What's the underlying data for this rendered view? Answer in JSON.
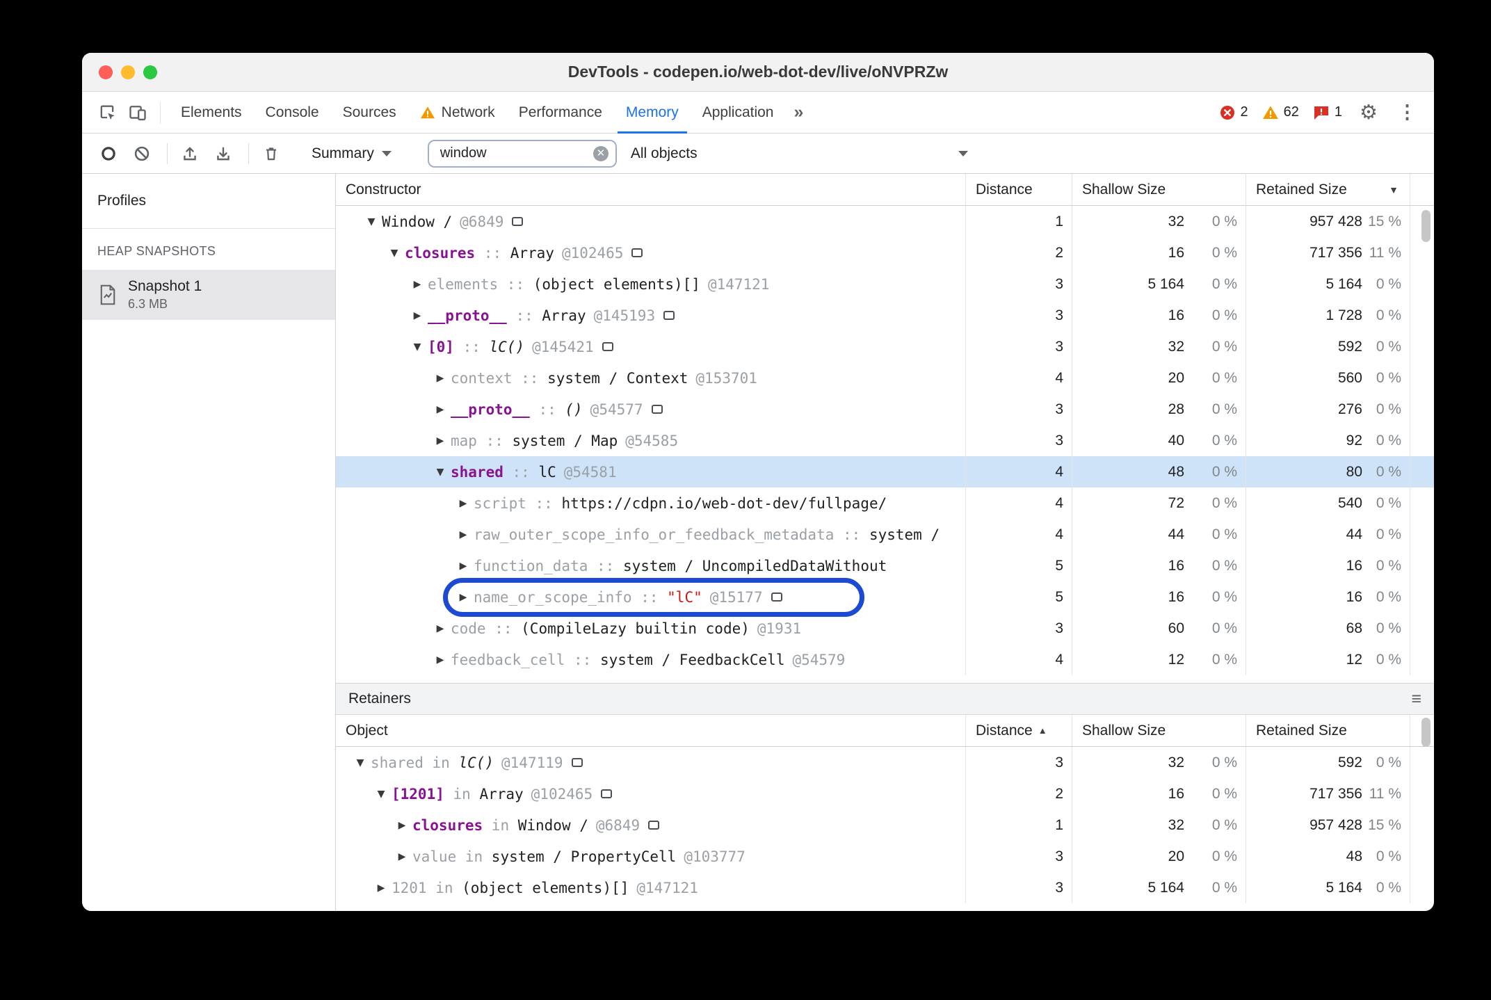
{
  "window": {
    "title": "DevTools - codepen.io/web-dot-dev/live/oNVPRZw"
  },
  "tabs": {
    "items": [
      {
        "label": "Elements"
      },
      {
        "label": "Console"
      },
      {
        "label": "Sources"
      },
      {
        "label": "Network",
        "warning": true
      },
      {
        "label": "Performance"
      },
      {
        "label": "Memory",
        "selected": true
      },
      {
        "label": "Application"
      }
    ],
    "more_label": "»",
    "errors": "2",
    "warnings": "62",
    "issues": "1"
  },
  "toolbar": {
    "summary_label": "Summary",
    "search_value": "window",
    "objects_filter": "All objects"
  },
  "sidebar": {
    "title": "Profiles",
    "section": "HEAP SNAPSHOTS",
    "snapshot": {
      "name": "Snapshot 1",
      "size": "6.3 MB"
    }
  },
  "constructor_table": {
    "columns": {
      "name": "Constructor",
      "distance": "Distance",
      "shallow": "Shallow Size",
      "retained": "Retained Size"
    },
    "sort": "retained-desc",
    "rows": [
      {
        "level": 0,
        "arrow": "open",
        "name": "Window /",
        "name_style": "plain",
        "sep": "",
        "value": "",
        "value_style": "plain",
        "id": "@6849",
        "icon": true,
        "selected": false,
        "annotated": false,
        "distance": "1",
        "shallow": "32",
        "shallow_pct": "0 %",
        "retained": "957 428",
        "retained_pct": "15 %"
      },
      {
        "level": 1,
        "arrow": "open",
        "name": "closures",
        "name_style": "prop",
        "sep": " :: ",
        "value": "Array",
        "value_style": "plain",
        "id": "@102465",
        "icon": true,
        "selected": false,
        "annotated": false,
        "distance": "2",
        "shallow": "16",
        "shallow_pct": "0 %",
        "retained": "717 356",
        "retained_pct": "11 %"
      },
      {
        "level": 2,
        "arrow": "closed",
        "name": "elements",
        "name_style": "dim",
        "sep": " :: ",
        "value": "(object elements)[]",
        "value_style": "plain",
        "id": "@147121",
        "icon": false,
        "selected": false,
        "annotated": false,
        "distance": "3",
        "shallow": "5 164",
        "shallow_pct": "0 %",
        "retained": "5 164",
        "retained_pct": "0 %"
      },
      {
        "level": 2,
        "arrow": "closed",
        "name": "__proto__",
        "name_style": "prop",
        "sep": " :: ",
        "value": "Array",
        "value_style": "plain",
        "id": "@145193",
        "icon": true,
        "selected": false,
        "annotated": false,
        "distance": "3",
        "shallow": "16",
        "shallow_pct": "0 %",
        "retained": "1 728",
        "retained_pct": "0 %"
      },
      {
        "level": 2,
        "arrow": "open",
        "name": "[0]",
        "name_style": "prop",
        "sep": " :: ",
        "value": "lC()",
        "value_style": "fn",
        "id": "@145421",
        "icon": true,
        "selected": false,
        "annotated": false,
        "distance": "3",
        "shallow": "32",
        "shallow_pct": "0 %",
        "retained": "592",
        "retained_pct": "0 %"
      },
      {
        "level": 3,
        "arrow": "closed",
        "name": "context",
        "name_style": "dim",
        "sep": " :: ",
        "value": "system / Context",
        "value_style": "plain",
        "id": "@153701",
        "icon": false,
        "selected": false,
        "annotated": false,
        "distance": "4",
        "shallow": "20",
        "shallow_pct": "0 %",
        "retained": "560",
        "retained_pct": "0 %"
      },
      {
        "level": 3,
        "arrow": "closed",
        "name": "__proto__",
        "name_style": "prop",
        "sep": " :: ",
        "value": "()",
        "value_style": "fn",
        "id": "@54577",
        "icon": true,
        "selected": false,
        "annotated": false,
        "distance": "3",
        "shallow": "28",
        "shallow_pct": "0 %",
        "retained": "276",
        "retained_pct": "0 %"
      },
      {
        "level": 3,
        "arrow": "closed",
        "name": "map",
        "name_style": "dim",
        "sep": " :: ",
        "value": "system / Map",
        "value_style": "plain",
        "id": "@54585",
        "icon": false,
        "selected": false,
        "annotated": false,
        "distance": "3",
        "shallow": "40",
        "shallow_pct": "0 %",
        "retained": "92",
        "retained_pct": "0 %"
      },
      {
        "level": 3,
        "arrow": "open",
        "name": "shared",
        "name_style": "prop",
        "sep": " :: ",
        "value": "lC",
        "value_style": "plain",
        "id": "@54581",
        "icon": false,
        "selected": true,
        "annotated": false,
        "distance": "4",
        "shallow": "48",
        "shallow_pct": "0 %",
        "retained": "80",
        "retained_pct": "0 %"
      },
      {
        "level": 4,
        "arrow": "closed",
        "name": "script",
        "name_style": "dim",
        "sep": " :: ",
        "value": "https://cdpn.io/web-dot-dev/fullpage/",
        "value_style": "plain",
        "id": "",
        "icon": false,
        "selected": false,
        "annotated": false,
        "distance": "4",
        "shallow": "72",
        "shallow_pct": "0 %",
        "retained": "540",
        "retained_pct": "0 %"
      },
      {
        "level": 4,
        "arrow": "closed",
        "name": "raw_outer_scope_info_or_feedback_metadata",
        "name_style": "dim",
        "sep": " :: ",
        "value": "system /",
        "value_style": "plain",
        "id": "",
        "icon": false,
        "selected": false,
        "annotated": false,
        "distance": "4",
        "shallow": "44",
        "shallow_pct": "0 %",
        "retained": "44",
        "retained_pct": "0 %"
      },
      {
        "level": 4,
        "arrow": "closed",
        "name": "function_data",
        "name_style": "dim",
        "sep": " :: ",
        "value": "system / UncompiledDataWithout",
        "value_style": "plain",
        "id": "",
        "icon": false,
        "selected": false,
        "annotated": false,
        "distance": "5",
        "shallow": "16",
        "shallow_pct": "0 %",
        "retained": "16",
        "retained_pct": "0 %"
      },
      {
        "level": 4,
        "arrow": "closed",
        "name": "name_or_scope_info",
        "name_style": "dim",
        "sep": " :: ",
        "value": "\"lC\"",
        "value_style": "str",
        "id": "@15177",
        "icon": true,
        "selected": false,
        "annotated": true,
        "distance": "5",
        "shallow": "16",
        "shallow_pct": "0 %",
        "retained": "16",
        "retained_pct": "0 %"
      },
      {
        "level": 3,
        "arrow": "closed",
        "name": "code",
        "name_style": "dim",
        "sep": " :: ",
        "value": "(CompileLazy builtin code)",
        "value_style": "plain",
        "id": "@1931",
        "icon": false,
        "selected": false,
        "annotated": false,
        "distance": "3",
        "shallow": "60",
        "shallow_pct": "0 %",
        "retained": "68",
        "retained_pct": "0 %"
      },
      {
        "level": 3,
        "arrow": "closed",
        "name": "feedback_cell",
        "name_style": "dim",
        "sep": " :: ",
        "value": "system / FeedbackCell",
        "value_style": "plain",
        "id": "@54579",
        "icon": false,
        "selected": false,
        "annotated": false,
        "distance": "4",
        "shallow": "12",
        "shallow_pct": "0 %",
        "retained": "12",
        "retained_pct": "0 %"
      }
    ]
  },
  "retainers": {
    "title": "Retainers",
    "columns": {
      "name": "Object",
      "distance": "Distance",
      "shallow": "Shallow Size",
      "retained": "Retained Size"
    },
    "sort": "distance-asc",
    "rows": [
      {
        "level": 0,
        "arrow": "open",
        "name": "shared",
        "name_style": "dim",
        "sep": " in ",
        "value": "lC()",
        "value_style": "fn",
        "id": "@147119",
        "icon": true,
        "selected": false,
        "annotated": false,
        "distance": "3",
        "shallow": "32",
        "shallow_pct": "0 %",
        "retained": "592",
        "retained_pct": "0 %"
      },
      {
        "level": 1,
        "arrow": "open",
        "name": "[1201]",
        "name_style": "prop",
        "sep": " in ",
        "value": "Array",
        "value_style": "plain",
        "id": "@102465",
        "icon": true,
        "selected": false,
        "annotated": false,
        "distance": "2",
        "shallow": "16",
        "shallow_pct": "0 %",
        "retained": "717 356",
        "retained_pct": "11 %"
      },
      {
        "level": 2,
        "arrow": "closed",
        "name": "closures",
        "name_style": "prop",
        "sep": " in ",
        "value": "Window /",
        "value_style": "plain",
        "id": "@6849",
        "icon": true,
        "selected": false,
        "annotated": false,
        "distance": "1",
        "shallow": "32",
        "shallow_pct": "0 %",
        "retained": "957 428",
        "retained_pct": "15 %"
      },
      {
        "level": 2,
        "arrow": "closed",
        "name": "value",
        "name_style": "dim",
        "sep": " in ",
        "value": "system / PropertyCell",
        "value_style": "plain",
        "id": "@103777",
        "icon": false,
        "selected": false,
        "annotated": false,
        "distance": "3",
        "shallow": "20",
        "shallow_pct": "0 %",
        "retained": "48",
        "retained_pct": "0 %"
      },
      {
        "level": 1,
        "arrow": "closed",
        "name": "1201",
        "name_style": "dim",
        "sep": " in ",
        "value": "(object elements)[]",
        "value_style": "plain",
        "id": "@147121",
        "icon": false,
        "selected": false,
        "annotated": false,
        "distance": "3",
        "shallow": "5 164",
        "shallow_pct": "0 %",
        "retained": "5 164",
        "retained_pct": "0 %"
      }
    ]
  },
  "colors": {
    "accent": "#1a73e8",
    "purple": "#881391",
    "dim": "#9aa0a6",
    "str": "#c41a16",
    "sel": "#cfe3f8",
    "anno": "#1c4ad3",
    "error": "#d93025",
    "warning": "#f29900"
  }
}
